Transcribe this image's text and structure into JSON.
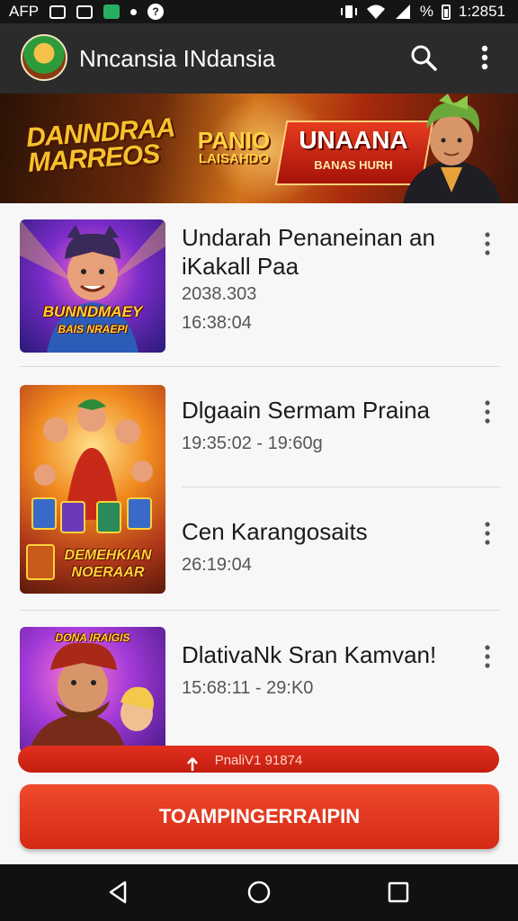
{
  "status_bar": {
    "carrier": "AFP",
    "signal_text": "%",
    "time": "1:2851"
  },
  "app_bar": {
    "title": "Nncansia INdansia",
    "logo_icon": "game-avatar-logo",
    "search_icon": "search-icon",
    "menu_icon": "more-vert-icon"
  },
  "banner": {
    "logo_text": "DANNDRAA MARREOS",
    "center_text": "PANIO",
    "center_sub": "LAISAHDO",
    "promo_title": "UNAANA",
    "promo_sub": "BANAS HURH"
  },
  "items": [
    {
      "title": "Undarah Penaneinan an iKakall Paa",
      "meta1": "2038.303",
      "meta2": "16:38:04",
      "thumb_text": "BUNNDMAEY",
      "thumb_sub": "BAIS NRAEPI"
    },
    {
      "title": "Dlgaain Sermam Praina",
      "meta1": "19:35:02 - 19:60g",
      "thumb_text": "DEMEHKIAN NOERAAR"
    },
    {
      "title": "Cen Karangosaits",
      "meta1": "26:19:04"
    },
    {
      "title": "DlativaNk Sran Kamvan!",
      "meta1": "15:68:11 - 29:K0",
      "thumb_text": "DONA IRAIGIS"
    }
  ],
  "pill_text": "PnaliV1 91874",
  "action_button": "TOAMPINGERRAIPIN",
  "nav": {
    "back_icon": "back-icon",
    "home_icon": "home-icon",
    "recents_icon": "recents-icon"
  },
  "colors": {
    "accent": "#E23A1E",
    "app_bar": "#2B2B2B",
    "list_bg": "#F7F7F7"
  }
}
